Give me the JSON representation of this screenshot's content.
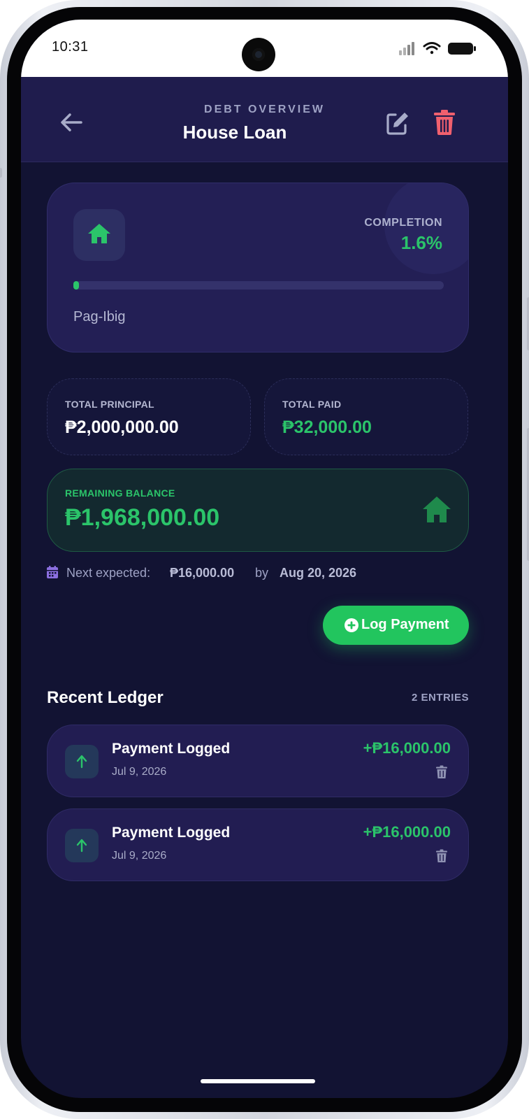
{
  "status_bar": {
    "time": "10:31"
  },
  "header": {
    "subtitle": "DEBT OVERVIEW",
    "title": "House Loan"
  },
  "hero": {
    "completion_label": "COMPLETION",
    "completion_value": "1.6%",
    "progress_fraction": 0.016,
    "lender": "Pag-Ibig",
    "icon": "home-icon"
  },
  "stats": {
    "principal_label": "TOTAL PRINCIPAL",
    "principal_value": "₱2,000,000.00",
    "paid_label": "TOTAL PAID",
    "paid_value": "₱32,000.00"
  },
  "balance": {
    "label": "REMAINING BALANCE",
    "value": "₱1,968,000.00",
    "icon": "home-icon"
  },
  "next_payment": {
    "prefix": "Next expected:",
    "amount": "₱16,000.00",
    "by": "by",
    "date": "Aug 20, 2026",
    "icon": "calendar-icon"
  },
  "log_button": {
    "label": "Log Payment",
    "icon": "plus-circle-icon"
  },
  "ledger": {
    "title": "Recent Ledger",
    "count": "2 ENTRIES",
    "items": [
      {
        "title": "Payment Logged",
        "date": "Jul 9, 2026",
        "amount": "+₱16,000.00"
      },
      {
        "title": "Payment Logged",
        "date": "Jul 9, 2026",
        "amount": "+₱16,000.00"
      }
    ]
  },
  "colors": {
    "accent_green": "#22c55e",
    "delete_red": "#f0606e",
    "header_bg": "#1f1c4d",
    "screen_bg": "#121333"
  }
}
